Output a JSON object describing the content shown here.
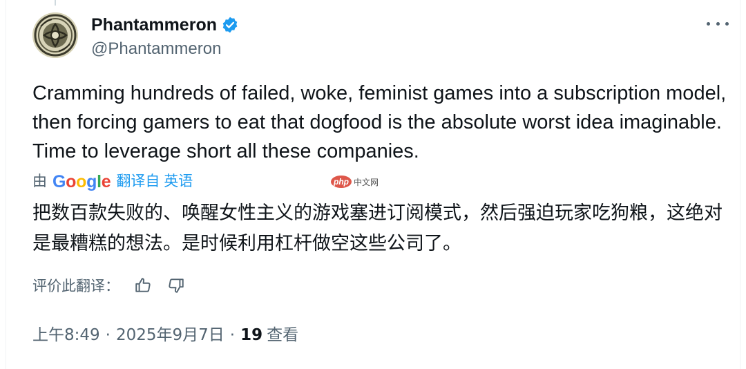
{
  "author": {
    "display_name": "Phantammeron",
    "handle": "@Phantammeron"
  },
  "tweet": {
    "text": "Cramming hundreds of failed, woke, feminist games into a subscription model, then forcing gamers to eat that dogfood is the absolute worst idea imaginable. Time to leverage short all these companies."
  },
  "translation": {
    "by_label": "由",
    "provider": "Google",
    "translated_from": "翻译自 英语",
    "text": "把数百款失败的、唤醒女性主义的游戏塞进订阅模式，然后强迫玩家吃狗粮，这绝对是最糟糕的想法。是时候利用杠杆做空这些公司了。",
    "rate_label": "评价此翻译："
  },
  "watermark": {
    "badge": "php",
    "text": "中文网"
  },
  "meta": {
    "time": "上午8:49",
    "separator": "·",
    "date": "2025年9月7日",
    "views_count": "19",
    "views_label": "查看"
  },
  "colors": {
    "accent": "#1d9bf0",
    "text": "#0f1419",
    "secondary": "#536471",
    "verified": "#1d9bf0"
  }
}
